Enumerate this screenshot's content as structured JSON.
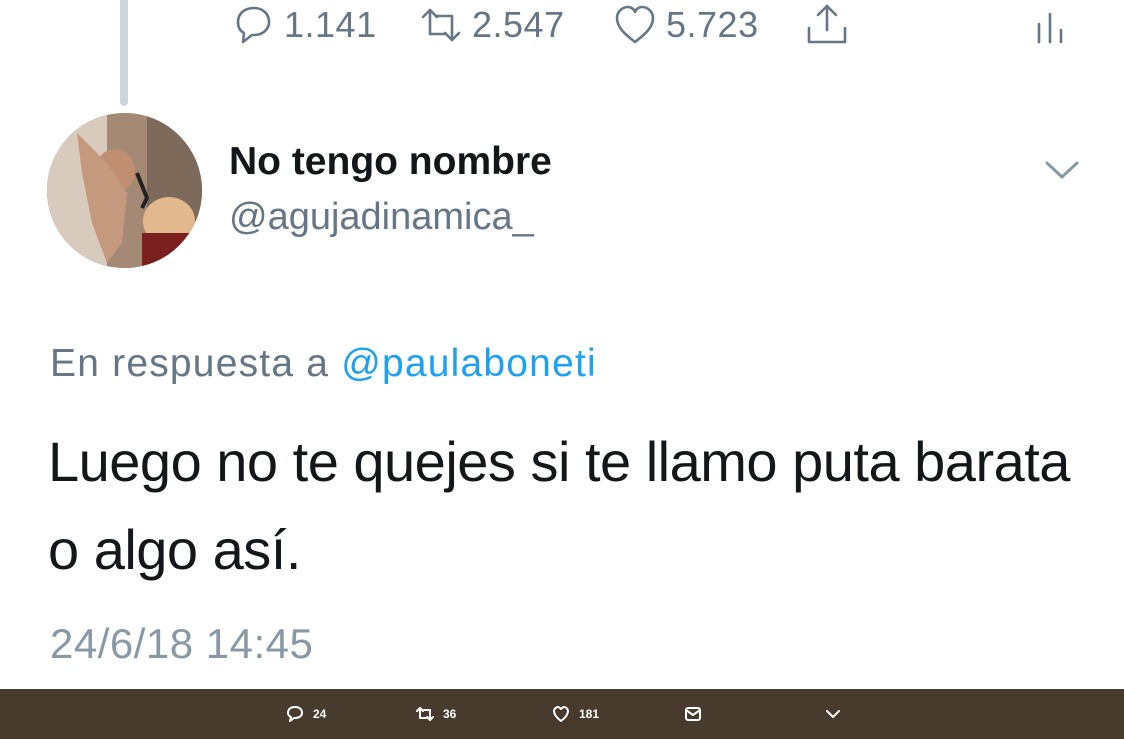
{
  "previous_tweet": {
    "replies_count": "1.141",
    "retweets_count": "2.547",
    "likes_count": "5.723"
  },
  "tweet": {
    "display_name": "No tengo nombre",
    "handle": "@agujadinamica_",
    "reply_prefix": "En respuesta a",
    "reply_mention": "@paulaboneti",
    "text": "Luego no te quejes si te llamo puta barata o algo así.",
    "timestamp": "24/6/18 14:45"
  },
  "bottom_bar": {
    "replies_count": "24",
    "retweets_count": "36",
    "likes_count": "181"
  },
  "icons": [
    "reply-icon",
    "retweet-icon",
    "like-icon",
    "share-icon",
    "analytics-icon",
    "chevron-down-icon",
    "message-icon"
  ],
  "colors": {
    "muted_text": "#657786",
    "link_blue": "#1da1f2",
    "bottom_bar_bg": "#493a2e"
  }
}
